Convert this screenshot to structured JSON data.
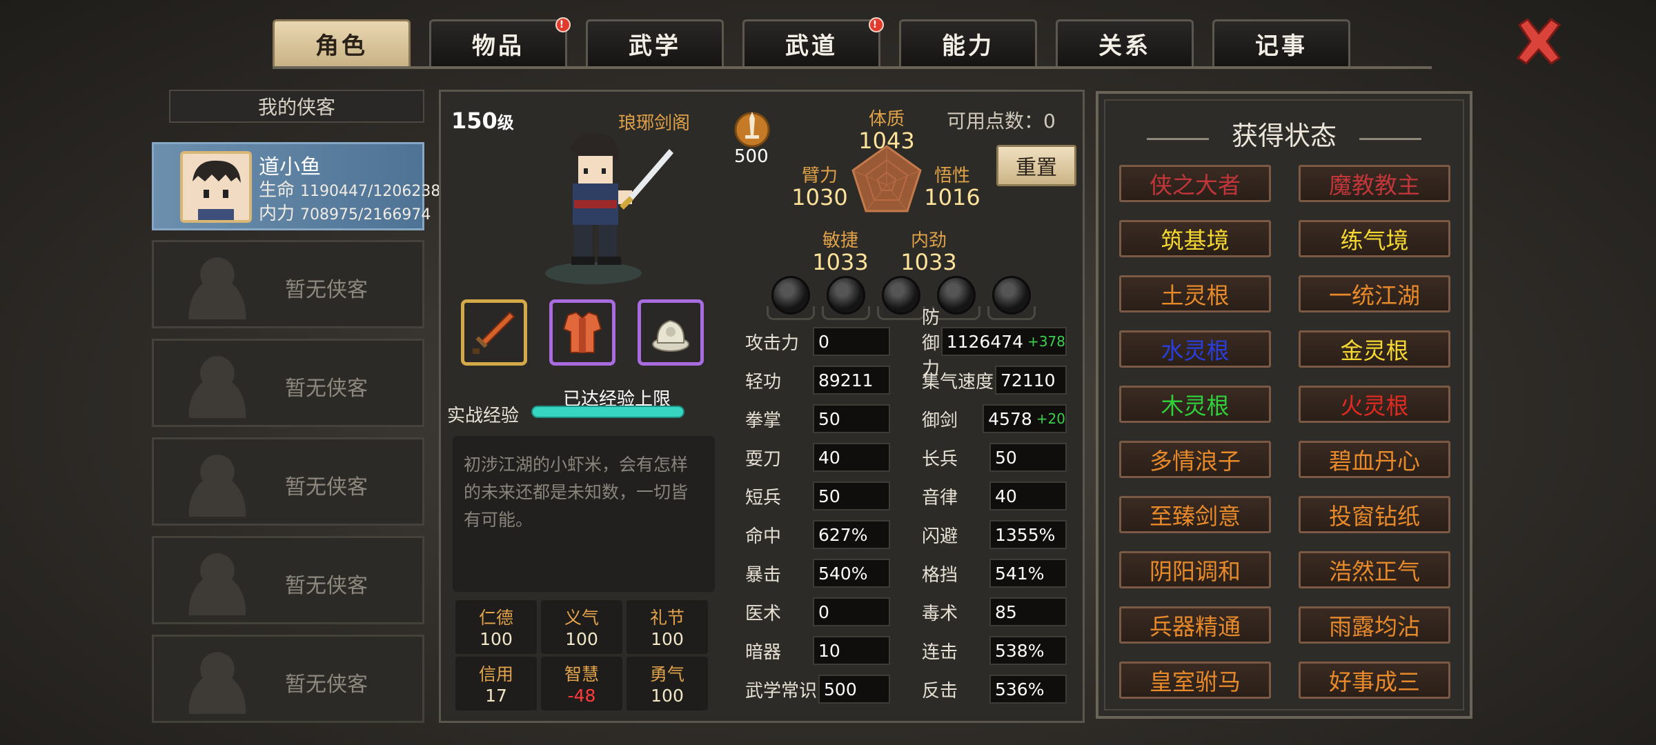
{
  "tabs": [
    {
      "label": "角色",
      "active": true,
      "alert": false
    },
    {
      "label": "物品",
      "active": false,
      "alert": true
    },
    {
      "label": "武学",
      "active": false,
      "alert": false
    },
    {
      "label": "武道",
      "active": false,
      "alert": true
    },
    {
      "label": "能力",
      "active": false,
      "alert": false
    },
    {
      "label": "关系",
      "active": false,
      "alert": false
    },
    {
      "label": "记事",
      "active": false,
      "alert": false
    }
  ],
  "alert_mark": "!",
  "list": {
    "title": "我的侠客",
    "hero": {
      "name": "道小鱼",
      "hp_label": "生命",
      "hp_value": "1190447/1206238",
      "mp_label": "内力",
      "mp_value": "708975/2166974"
    },
    "empty_label": "暂无侠客"
  },
  "character": {
    "level": "150",
    "level_unit": "级",
    "sect": "琅琊剑阁",
    "medal_value": "500",
    "points_label": "可用点数：0",
    "reset_label": "重置",
    "attributes": {
      "tizhi": {
        "name": "体质",
        "value": "1043"
      },
      "bili": {
        "name": "臂力",
        "value": "1030"
      },
      "wuxing": {
        "name": "悟性",
        "value": "1016"
      },
      "minjie": {
        "name": "敏捷",
        "value": "1033"
      },
      "neijin": {
        "name": "内劲",
        "value": "1033"
      }
    },
    "exp_label": "实战经验",
    "exp_status": "已达经验上限",
    "exp_fill": 1.0,
    "description": "初涉江湖的小虾米，会有怎样的未来还都是未知数，一切皆有可能。",
    "virtues": [
      {
        "name": "仁德",
        "value": "100",
        "negative": false
      },
      {
        "name": "义气",
        "value": "100",
        "negative": false
      },
      {
        "name": "礼节",
        "value": "100",
        "negative": false
      },
      {
        "name": "信用",
        "value": "17",
        "negative": false
      },
      {
        "name": "智慧",
        "value": "-48",
        "negative": true
      },
      {
        "name": "勇气",
        "value": "100",
        "negative": false
      }
    ]
  },
  "stats_left": [
    {
      "label": "攻击力",
      "value": "0"
    },
    {
      "label": "轻功",
      "value": "89211"
    },
    {
      "label": "拳掌",
      "value": "50"
    },
    {
      "label": "耍刀",
      "value": "40"
    },
    {
      "label": "短兵",
      "value": "50"
    },
    {
      "label": "命中",
      "value": "627%"
    },
    {
      "label": "暴击",
      "value": "540%"
    },
    {
      "label": "医术",
      "value": "0"
    },
    {
      "label": "暗器",
      "value": "10"
    },
    {
      "label": "武学常识",
      "value": "500"
    }
  ],
  "stats_right": [
    {
      "label": "防御力",
      "value": "1126474",
      "bonus": "+378"
    },
    {
      "label": "集气速度",
      "value": "72110",
      "bonus": ""
    },
    {
      "label": "御剑",
      "value": "4578",
      "bonus": "+20"
    },
    {
      "label": "长兵",
      "value": "50",
      "bonus": ""
    },
    {
      "label": "音律",
      "value": "40",
      "bonus": ""
    },
    {
      "label": "闪避",
      "value": "1355%",
      "bonus": ""
    },
    {
      "label": "格挡",
      "value": "541%",
      "bonus": ""
    },
    {
      "label": "毒术",
      "value": "85",
      "bonus": ""
    },
    {
      "label": "连击",
      "value": "538%",
      "bonus": ""
    },
    {
      "label": "反击",
      "value": "536%",
      "bonus": ""
    }
  ],
  "status_panel": {
    "title": "获得状态",
    "items": [
      {
        "label": "侠之大者",
        "color": "#c0363a"
      },
      {
        "label": "魔教教主",
        "color": "#c0363a"
      },
      {
        "label": "筑基境",
        "color": "#f5d830"
      },
      {
        "label": "练气境",
        "color": "#f5d830"
      },
      {
        "label": "土灵根",
        "color": "#e8892a"
      },
      {
        "label": "一统江湖",
        "color": "#e8892a"
      },
      {
        "label": "水灵根",
        "color": "#2a3ee0"
      },
      {
        "label": "金灵根",
        "color": "#f5d830"
      },
      {
        "label": "木灵根",
        "color": "#2fd03a"
      },
      {
        "label": "火灵根",
        "color": "#e02a22"
      },
      {
        "label": "多情浪子",
        "color": "#e8892a"
      },
      {
        "label": "碧血丹心",
        "color": "#e8892a"
      },
      {
        "label": "至臻剑意",
        "color": "#e8892a"
      },
      {
        "label": "投窗钻纸",
        "color": "#e8892a"
      },
      {
        "label": "阴阳调和",
        "color": "#e8892a"
      },
      {
        "label": "浩然正气",
        "color": "#e8892a"
      },
      {
        "label": "兵器精通",
        "color": "#e8892a"
      },
      {
        "label": "雨露均沾",
        "color": "#e8892a"
      },
      {
        "label": "皇室驸马",
        "color": "#e8892a"
      },
      {
        "label": "好事成三",
        "color": "#e8892a"
      }
    ]
  },
  "icons": {
    "close": "close-x-icon",
    "medal": "sword-medal-icon",
    "weapon": "sword-icon",
    "armor": "armor-icon",
    "accessory": "jade-seal-icon"
  }
}
